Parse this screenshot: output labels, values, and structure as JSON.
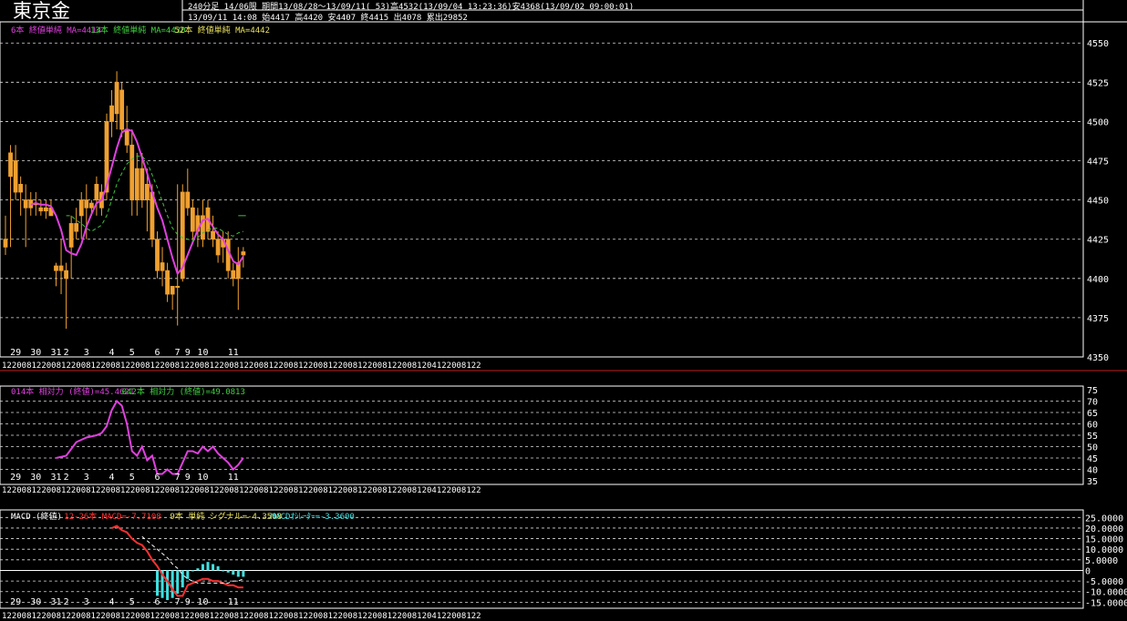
{
  "header": {
    "title": "東京金",
    "info_line1": "240分足  14/06限  期間13/08/28～13/09/11( 53)高4532(13/09/04 13:23:36)安4368(13/09/02 09:00:01)",
    "info_line2": "13/09/11 14:08 始4417 高4420 安4407 終4415 出4078 累出29852"
  },
  "price_panel": {
    "legend": [
      {
        "text": "6本 終値単純 MA=4414",
        "color": "#e040e0"
      },
      {
        "text": "13本 終値単純 MA=4430",
        "color": "#40d040"
      },
      {
        "text": "52本 終値単純 MA=4442",
        "color": "#e8e060"
      }
    ],
    "yticks": [
      "4550",
      "4525",
      "4500",
      "4475",
      "4450",
      "4425",
      "4400",
      "4375",
      "4350"
    ],
    "day_labels": [
      {
        "t": "29",
        "i": 2
      },
      {
        "t": "30",
        "i": 6
      },
      {
        "t": "31",
        "i": 10
      },
      {
        "t": "2",
        "i": 12
      },
      {
        "t": "3",
        "i": 16
      },
      {
        "t": "4",
        "i": 21
      },
      {
        "t": "5",
        "i": 25
      },
      {
        "t": "6",
        "i": 30
      },
      {
        "t": "7",
        "i": 34
      },
      {
        "t": "9",
        "i": 36
      },
      {
        "t": "10",
        "i": 39
      },
      {
        "t": "11",
        "i": 45
      }
    ],
    "time_strip": "1220081220081220081220081220081220081220081220081220081220081220081220081220081220081204122008122"
  },
  "rsi_panel": {
    "legend": [
      {
        "text": "014本 相対力 (終値)=45.4621",
        "color": "#e040e0"
      },
      {
        "text": "042本 相対力 (終値)=49.0813",
        "color": "#40d040"
      }
    ],
    "yticks": [
      "75",
      "70",
      "65",
      "60",
      "55",
      "50",
      "45",
      "40",
      "35"
    ]
  },
  "macd_panel": {
    "legend": [
      {
        "text": "MACD (終値)",
        "color": "#ffffff"
      },
      {
        "text": "12-26本 MACD=-7.7108",
        "color": "#ff3030"
      },
      {
        "text": "9本 単純 シグナル=-4.3508",
        "color": "#e8e060"
      },
      {
        "text": "MACDｵｼﾚｰﾀｰ=-3.3600",
        "color": "#40e0e0"
      }
    ],
    "yticks": [
      "25.0000",
      "20.0000",
      "15.0000",
      "10.0000",
      "5.0000",
      "0",
      "-5.0000",
      "-10.0000",
      "-15.0000"
    ]
  },
  "chart_data": [
    {
      "type": "candlestick",
      "title": "",
      "ylim": [
        4350,
        4560
      ],
      "candles": [
        {
          "o": 4420,
          "h": 4440,
          "l": 4415,
          "c": 4425
        },
        {
          "o": 4465,
          "h": 4485,
          "l": 4420,
          "c": 4480
        },
        {
          "o": 4475,
          "h": 4485,
          "l": 4450,
          "c": 4455
        },
        {
          "o": 4455,
          "h": 4465,
          "l": 4440,
          "c": 4460
        },
        {
          "o": 4445,
          "h": 4460,
          "l": 4420,
          "c": 4450
        },
        {
          "o": 4450,
          "h": 4455,
          "l": 4440,
          "c": 4445
        },
        {
          "o": 4448,
          "h": 4455,
          "l": 4440,
          "c": 4447
        },
        {
          "o": 4445,
          "h": 4450,
          "l": 4440,
          "c": 4443
        },
        {
          "o": 4443,
          "h": 4450,
          "l": 4438,
          "c": 4445
        },
        {
          "o": 4445,
          "h": 4450,
          "l": 4440,
          "c": 4440
        },
        {
          "o": 4405,
          "h": 4410,
          "l": 4395,
          "c": 4408
        },
        {
          "o": 4408,
          "h": 4425,
          "l": 4390,
          "c": 4405
        },
        {
          "o": 4405,
          "h": 4410,
          "l": 4368,
          "c": 4400
        },
        {
          "o": 4420,
          "h": 4440,
          "l": 4400,
          "c": 4435
        },
        {
          "o": 4435,
          "h": 4445,
          "l": 4425,
          "c": 4430
        },
        {
          "o": 4440,
          "h": 4455,
          "l": 4425,
          "c": 4450
        },
        {
          "o": 4450,
          "h": 4460,
          "l": 4425,
          "c": 4445
        },
        {
          "o": 4445,
          "h": 4450,
          "l": 4440,
          "c": 4448
        },
        {
          "o": 4450,
          "h": 4465,
          "l": 4440,
          "c": 4460
        },
        {
          "o": 4445,
          "h": 4460,
          "l": 4440,
          "c": 4455
        },
        {
          "o": 4455,
          "h": 4505,
          "l": 4450,
          "c": 4500
        },
        {
          "o": 4500,
          "h": 4520,
          "l": 4490,
          "c": 4510
        },
        {
          "o": 4505,
          "h": 4532,
          "l": 4495,
          "c": 4525
        },
        {
          "o": 4520,
          "h": 4525,
          "l": 4490,
          "c": 4495
        },
        {
          "o": 4495,
          "h": 4510,
          "l": 4480,
          "c": 4485
        },
        {
          "o": 4485,
          "h": 4495,
          "l": 4440,
          "c": 4450
        },
        {
          "o": 4450,
          "h": 4480,
          "l": 4440,
          "c": 4470
        },
        {
          "o": 4470,
          "h": 4480,
          "l": 4445,
          "c": 4450
        },
        {
          "o": 4450,
          "h": 4470,
          "l": 4430,
          "c": 4460
        },
        {
          "o": 4455,
          "h": 4460,
          "l": 4420,
          "c": 4425
        },
        {
          "o": 4425,
          "h": 4430,
          "l": 4400,
          "c": 4405
        },
        {
          "o": 4410,
          "h": 4420,
          "l": 4395,
          "c": 4405
        },
        {
          "o": 4405,
          "h": 4410,
          "l": 4385,
          "c": 4390
        },
        {
          "o": 4390,
          "h": 4395,
          "l": 4380,
          "c": 4395
        },
        {
          "o": 4395,
          "h": 4460,
          "l": 4370,
          "c": 4395
        },
        {
          "o": 4400,
          "h": 4460,
          "l": 4398,
          "c": 4455
        },
        {
          "o": 4455,
          "h": 4470,
          "l": 4440,
          "c": 4445
        },
        {
          "o": 4445,
          "h": 4450,
          "l": 4425,
          "c": 4430
        },
        {
          "o": 4430,
          "h": 4445,
          "l": 4420,
          "c": 4440
        },
        {
          "o": 4440,
          "h": 4450,
          "l": 4420,
          "c": 4425
        },
        {
          "o": 4445,
          "h": 4450,
          "l": 4425,
          "c": 4430
        },
        {
          "o": 4430,
          "h": 4440,
          "l": 4420,
          "c": 4425
        },
        {
          "o": 4425,
          "h": 4430,
          "l": 4410,
          "c": 4415
        },
        {
          "o": 4420,
          "h": 4430,
          "l": 4410,
          "c": 4425
        },
        {
          "o": 4425,
          "h": 4430,
          "l": 4400,
          "c": 4405
        },
        {
          "o": 4405,
          "h": 4410,
          "l": 4395,
          "c": 4400
        },
        {
          "o": 4400,
          "h": 4420,
          "l": 4380,
          "c": 4410
        },
        {
          "o": 4417,
          "h": 4420,
          "l": 4407,
          "c": 4415
        }
      ],
      "ma6": [
        null,
        null,
        null,
        null,
        null,
        4447,
        4448,
        4447,
        4447,
        4446,
        4440,
        4431,
        4418,
        4416,
        4415,
        4422,
        4433,
        4441,
        4448,
        4450,
        4459,
        4471,
        4483,
        4493,
        4495,
        4494,
        4487,
        4477,
        4467,
        4455,
        4445,
        4437,
        4425,
        4413,
        4403,
        4407,
        4415,
        4423,
        4431,
        4437,
        4438,
        4433,
        4428,
        4425,
        4418,
        4411,
        4409,
        4414
      ],
      "ma13": [
        null,
        null,
        null,
        null,
        null,
        null,
        null,
        null,
        null,
        null,
        null,
        null,
        4440,
        4440,
        4437,
        4435,
        4432,
        4430,
        4432,
        4434,
        4440,
        4450,
        4460,
        4467,
        4473,
        4476,
        4478,
        4478,
        4474,
        4466,
        4458,
        4449,
        4440,
        4432,
        4428,
        4426,
        4425,
        4424,
        4426,
        4429,
        4431,
        4432,
        4432,
        4430,
        4428,
        4427,
        4429,
        4430
      ],
      "series": [
        {
          "name": "6本 終値単純 MA",
          "key": "ma6",
          "color": "#e040e0",
          "dash": false
        },
        {
          "name": "13本 終値単純 MA",
          "key": "ma13",
          "color": "#40c040",
          "dash": true
        }
      ],
      "ma52_values": [
        4440,
        4440
      ]
    },
    {
      "type": "line",
      "ylim": [
        35,
        75
      ],
      "series": [
        {
          "name": "014本 相対力 (終値)",
          "color": "#e040e0",
          "x": [
            10,
            12,
            14,
            16,
            18,
            19,
            20,
            21,
            22,
            23,
            24,
            25,
            26,
            27,
            28,
            29,
            30,
            31,
            32,
            33,
            34,
            35,
            36,
            37,
            38,
            39,
            40,
            41,
            42,
            43,
            44,
            45,
            46,
            47
          ],
          "y": [
            45,
            46,
            52,
            54,
            55,
            56,
            59,
            66,
            70,
            68,
            60,
            48,
            46,
            50,
            44,
            46,
            38,
            38,
            40,
            38,
            38,
            43,
            48,
            48,
            47,
            50,
            48,
            50,
            47,
            45,
            43,
            40,
            42,
            45
          ]
        }
      ]
    },
    {
      "type": "line",
      "ylim": [
        -17,
        26
      ],
      "series": [
        {
          "name": "12-26本 MACD",
          "color": "#ff3030",
          "dash": false,
          "x": [
            21,
            22,
            23,
            24,
            25,
            26,
            27,
            28,
            29,
            30,
            31,
            32,
            33,
            34,
            35,
            36,
            37,
            38,
            39,
            40,
            41,
            42,
            43,
            44,
            45,
            46,
            47
          ],
          "y": [
            20,
            21,
            19,
            18,
            15,
            13,
            12,
            9,
            5,
            2,
            -2,
            -5,
            -9,
            -12,
            -12,
            -7,
            -6,
            -5,
            -4,
            -4,
            -5,
            -5,
            -6,
            -7,
            -7,
            -8,
            -8
          ]
        },
        {
          "name": "9本 単純 シグナル",
          "color": "#ffffff",
          "dash": true,
          "x": [
            27,
            28,
            29,
            30,
            31,
            32,
            33,
            34,
            35,
            36,
            37,
            38,
            39,
            40,
            41,
            42,
            43,
            44,
            45,
            46,
            47
          ],
          "y": [
            16,
            14,
            12,
            10,
            8,
            6,
            3,
            1,
            -2,
            -4,
            -5,
            -6,
            -6,
            -6,
            -6,
            -6,
            -6,
            -6,
            -5,
            -5,
            -4
          ]
        }
      ],
      "hist": {
        "color": "#40e0e0",
        "x": [
          30,
          31,
          32,
          33,
          34,
          35,
          36,
          37,
          38,
          39,
          40,
          41,
          42,
          43,
          44,
          45,
          46,
          47
        ],
        "y": [
          -12,
          -13,
          -14,
          -13,
          -11,
          -8,
          -4,
          0,
          1,
          3,
          4,
          3,
          2,
          0,
          -1,
          -2,
          -3,
          -3
        ]
      }
    }
  ]
}
